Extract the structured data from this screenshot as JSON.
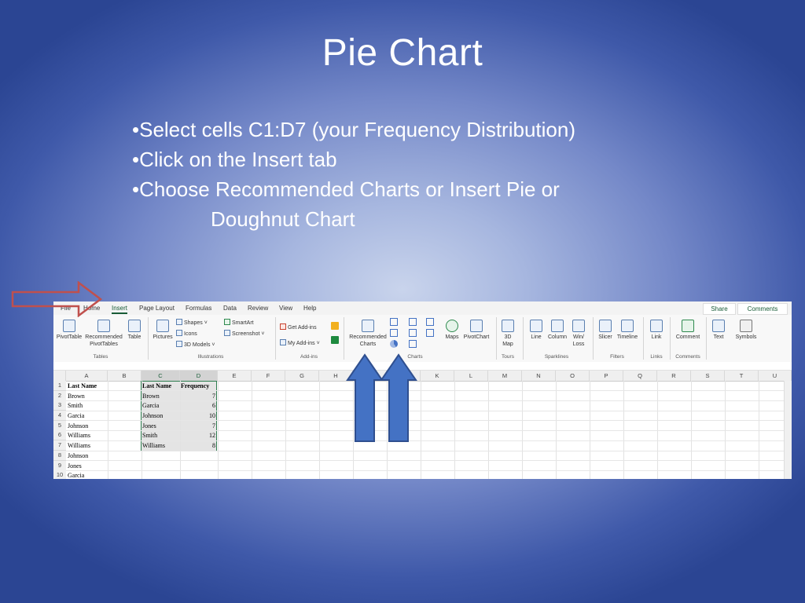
{
  "slide": {
    "title": "Pie Chart",
    "bullets": [
      "•Select cells C1:D7 (your Frequency Distribution)",
      "•Click on the Insert tab",
      "•Choose Recommended Charts or Insert Pie or",
      "Doughnut Chart"
    ]
  },
  "excel": {
    "tabs": [
      "File",
      "Home",
      "Insert",
      "Page Layout",
      "Formulas",
      "Data",
      "Review",
      "View",
      "Help"
    ],
    "active_tab": "Insert",
    "share": "Share",
    "comments": "Comments",
    "ribbon": {
      "pivottable": "PivotTable",
      "recommended_pivot": "Recommended",
      "recommended_pivot2": "PivotTables",
      "table": "Table",
      "group_tables": "Tables",
      "pictures": "Pictures",
      "shapes": "Shapes",
      "icons": "Icons",
      "models3d": "3D Models",
      "smartart": "SmartArt",
      "screenshot": "Screenshot",
      "group_illustrations": "Illustrations",
      "get_addins": "Get Add-ins",
      "my_addins": "My Add-ins",
      "group_addins": "Add-ins",
      "recommended_charts": "Recommended",
      "recommended_charts2": "Charts",
      "group_charts": "Charts",
      "maps": "Maps",
      "pivotchart": "PivotChart",
      "map3d": "3D",
      "map3d2": "Map",
      "group_tours": "Tours",
      "line": "Line",
      "column": "Column",
      "winloss": "Win/",
      "winloss2": "Loss",
      "group_sparklines": "Sparklines",
      "slicer": "Slicer",
      "timeline": "Timeline",
      "group_filters": "Filters",
      "link": "Link",
      "group_links": "Links",
      "comment": "Comment",
      "group_comments": "Comments",
      "text": "Text",
      "symbols": "Symbols"
    },
    "columns": [
      "A",
      "B",
      "C",
      "D",
      "E",
      "F",
      "G",
      "H",
      "I",
      "J",
      "K",
      "L",
      "M",
      "N",
      "O",
      "P",
      "Q",
      "R",
      "S",
      "T",
      "U"
    ],
    "rows": [
      "1",
      "2",
      "3",
      "4",
      "5",
      "6",
      "7",
      "8",
      "9",
      "10"
    ],
    "col_a": [
      "Last Name",
      "Brown",
      "Smith",
      "Garcia",
      "Johnson",
      "Williams",
      "Williams",
      "Johnson",
      "Jones",
      "Garcia"
    ],
    "col_c": [
      "Last Name",
      "Brown",
      "Garcia",
      "Johnson",
      "Jones",
      "Smith",
      "Williams"
    ],
    "col_d": [
      "Frequency",
      "7",
      "6",
      "10",
      "7",
      "12",
      "8"
    ]
  }
}
